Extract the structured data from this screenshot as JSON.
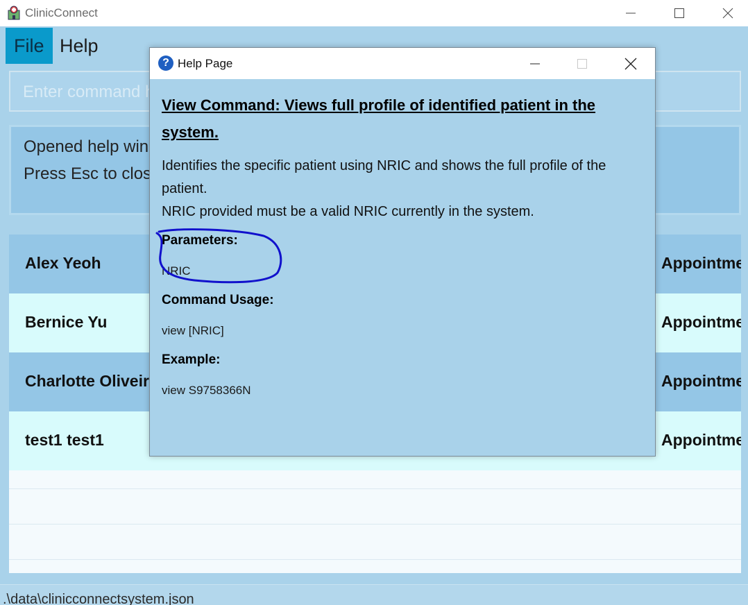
{
  "window": {
    "title": "ClinicConnect"
  },
  "menu": {
    "file": "File",
    "help": "Help"
  },
  "command": {
    "placeholder": "Enter command here..."
  },
  "result": {
    "line1": "Opened help window.",
    "line2": "Press Esc to close the help window."
  },
  "patients": [
    {
      "name": "Alex Yeoh",
      "right": "Appointment"
    },
    {
      "name": "Bernice Yu",
      "right": "Appointment"
    },
    {
      "name": "Charlotte Oliveiro",
      "right": "Appointment"
    },
    {
      "name": "test1 test1",
      "right": "Appointment"
    }
  ],
  "status": {
    "path": ".\\data\\clinicconnectsystem.json"
  },
  "help_dialog": {
    "title": "Help Page",
    "heading": "View Command: Views full profile of identified patient in the system.",
    "description_1": "Identifies the specific patient using NRIC and shows the full profile of the patient.",
    "description_2": "NRIC provided must be a valid NRIC currently in the system.",
    "parameters_label": "Parameters:",
    "parameters_value": "NRIC",
    "usage_label": "Command Usage:",
    "usage_value": "view [NRIC]",
    "example_label": "Example:",
    "example_value": "view S9758366N"
  },
  "colors": {
    "accent": "#0a9acb",
    "row_dark": "#94c6e6",
    "row_light": "#d8fbfc",
    "annotation": "#1111cc"
  }
}
